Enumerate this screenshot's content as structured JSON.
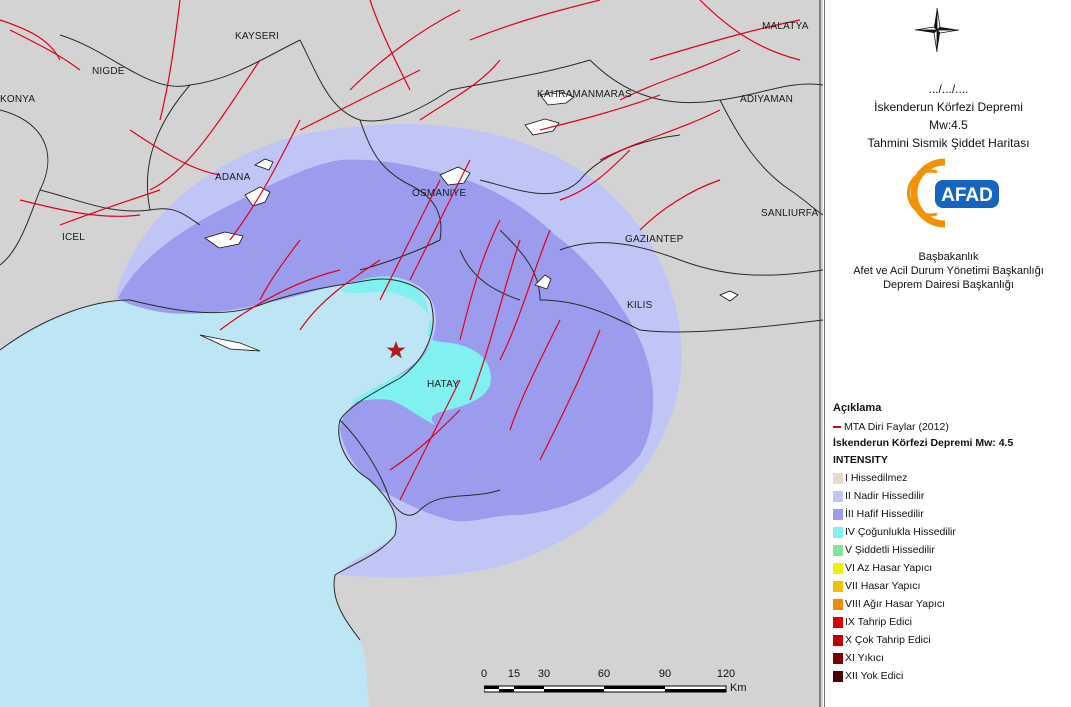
{
  "map": {
    "cities": [
      {
        "name": "KAYSERI"
      },
      {
        "name": "NIGDE"
      },
      {
        "name": "KONYA"
      },
      {
        "name": "ADANA"
      },
      {
        "name": "OSMANIYE"
      },
      {
        "name": "KAHRAMANMARAS"
      },
      {
        "name": "ADIYAMAN"
      },
      {
        "name": "MALATYA"
      },
      {
        "name": "ICEL"
      },
      {
        "name": "GAZIANTEP"
      },
      {
        "name": "SANLIURFA"
      },
      {
        "name": "KILIS"
      },
      {
        "name": "HATAY"
      }
    ],
    "epicenter": "epicenter-star",
    "colors": {
      "land": "#d3d3d3",
      "sea": "#bde6f4",
      "intensity_ii": "#bfc6f6",
      "intensity_iii": "#9b9cee",
      "intensity_iv": "#80f0f0",
      "fault": "#e0001b",
      "border": "#2a2a2a",
      "epicenter": "#b01c1c"
    }
  },
  "panel": {
    "date": ".../.../....",
    "title": "İskenderun Körfezi Depremi",
    "magnitude": "Mw:4.5",
    "subtitle": "Tahmini Sismik Şiddet Haritası",
    "logo_text": "AFAD",
    "agency_line1": "Başbakanlık",
    "agency_line2": "Afet ve Acil Durum Yönetimi Başkanlığı",
    "agency_line3": "Deprem Dairesi Başkanlığı"
  },
  "legend": {
    "title": "Açıklama",
    "fault_label": "MTA Diri Faylar (2012)",
    "event_label": "İskenderun Körfezi Depremi Mw: 4.5",
    "intensity_header": "INTENSITY",
    "classes": [
      {
        "label": "I Hissedilmez",
        "color": "#e3dcc8"
      },
      {
        "label": "II Nadir Hissedilir",
        "color": "#bfc6f6"
      },
      {
        "label": "İII Hafif Hissedilir",
        "color": "#9b9cee"
      },
      {
        "label": "IV Çoğunlukla Hissedilir",
        "color": "#80f0f0"
      },
      {
        "label": "V Şiddetli Hissedilir",
        "color": "#7ee59a"
      },
      {
        "label": "VI Az Hasar Yapıcı",
        "color": "#f2f200"
      },
      {
        "label": "VII Hasar Yapıcı",
        "color": "#f2c200"
      },
      {
        "label": "VIII Ağır Hasar Yapıcı",
        "color": "#f28a00"
      },
      {
        "label": "IX Tahrip Edici",
        "color": "#e00000"
      },
      {
        "label": "X Çok Tahrip Edici",
        "color": "#c00000"
      },
      {
        "label": "XI Yıkıcı",
        "color": "#7a0000"
      },
      {
        "label": "XII Yok Edici",
        "color": "#4a0000"
      }
    ]
  },
  "scale": {
    "ticks": [
      "0",
      "15",
      "30",
      "60",
      "90",
      "120"
    ],
    "unit": "Km"
  }
}
